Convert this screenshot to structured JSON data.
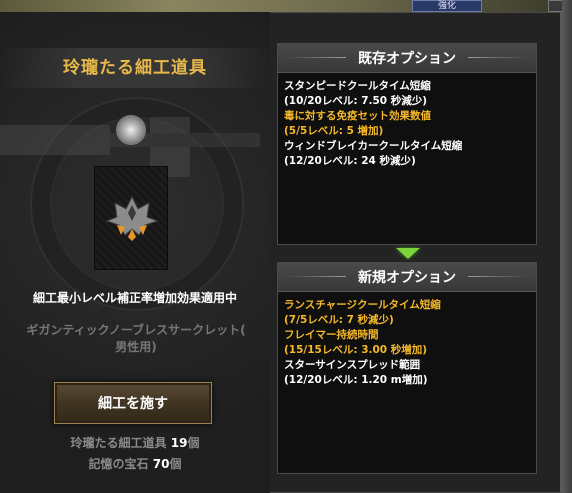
{
  "topbar": {
    "tab_label": "強化"
  },
  "left": {
    "title": "玲瓏たる細工道具",
    "notice": "細工最小レベル補正率増加効果適用中",
    "item_name_line1": "ギガンティックノーブレスサークレット(",
    "item_name_line2": "男性用)",
    "craft_button": "細工を施す",
    "costs": [
      {
        "label": "玲瓏たる細工道具 ",
        "amount": "19",
        "unit": "個"
      },
      {
        "label": "記憶の宝石 ",
        "amount": "70",
        "unit": "個"
      }
    ]
  },
  "existing": {
    "title": "既存オプション",
    "lines": [
      {
        "text": "スタンピードクールタイム短縮",
        "color": "white"
      },
      {
        "text": "(10/20レベル: 7.50 秒減少)",
        "color": "white"
      },
      {
        "text": "毒に対する免疫セット効果数値",
        "color": "gold"
      },
      {
        "text": "(5/5レベル: 5 増加)",
        "color": "gold"
      },
      {
        "text": "ウィンドブレイカークールタイム短縮",
        "color": "white"
      },
      {
        "text": "(12/20レベル: 24 秒減少)",
        "color": "white"
      }
    ]
  },
  "new": {
    "title": "新規オプション",
    "lines": [
      {
        "text": "ランスチャージクールタイム短縮",
        "color": "gold"
      },
      {
        "text": "(7/5レベル: 7 秒減少)",
        "color": "gold"
      },
      {
        "text": "フレイマー持続時間",
        "color": "gold"
      },
      {
        "text": "(15/15レベル: 3.00 秒増加)",
        "color": "gold"
      },
      {
        "text": "スターサインスプレッド範囲",
        "color": "white"
      },
      {
        "text": "(12/20レベル: 1.20 m増加)",
        "color": "white"
      }
    ]
  },
  "colors": {
    "title_gold": "#e8b94a",
    "option_gold": "#f5b82a",
    "arrow_green": "#7ad43a"
  }
}
